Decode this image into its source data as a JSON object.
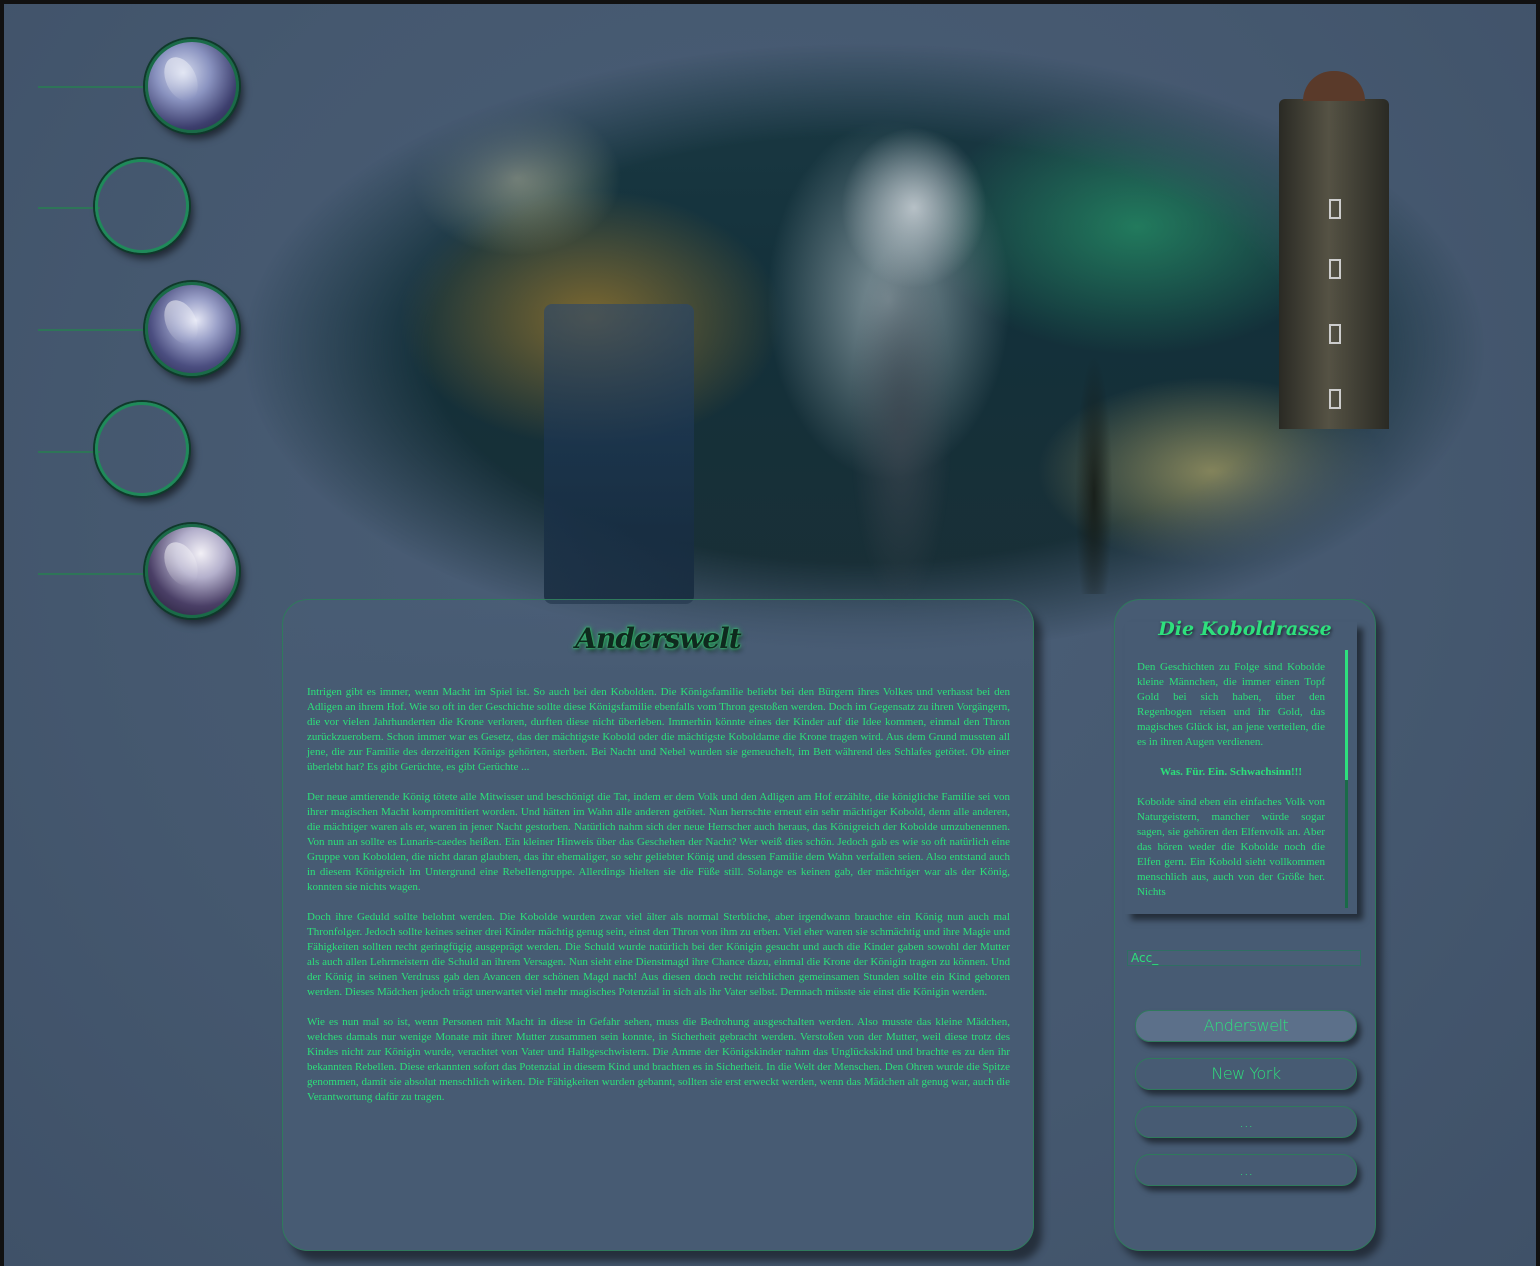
{
  "header": {
    "image_description_icon": "fantasy-banner-image"
  },
  "avatars": [
    {
      "state": "filled"
    },
    {
      "state": "empty"
    },
    {
      "state": "filled"
    },
    {
      "state": "empty"
    },
    {
      "state": "filled"
    }
  ],
  "main": {
    "title": "Anderswelt",
    "paragraphs": [
      "Intrigen gibt es immer, wenn Macht im Spiel ist. So auch bei den Kobolden. Die Königsfamilie beliebt bei den Bürgern ihres Volkes und verhasst bei den Adligen an ihrem Hof. Wie so oft in der Geschichte sollte diese Königsfamilie ebenfalls vom Thron gestoßen werden. Doch im Gegensatz zu ihren Vorgängern, die vor vielen Jahrhunderten die Krone verloren, durften diese nicht überleben. Immerhin könnte eines der Kinder auf die Idee kommen, einmal den Thron zurückzuerobern. Schon immer war es Gesetz, das der mächtigste Kobold oder die mächtigste Koboldame die Krone tragen wird. Aus dem Grund mussten all jene, die zur Familie des derzeitigen Königs gehörten, sterben. Bei Nacht und Nebel wurden sie gemeuchelt, im Bett während des Schlafes getötet. Ob einer überlebt hat? Es gibt Gerüchte, es gibt Gerüchte ...",
      "Der neue amtierende König tötete alle Mitwisser und beschönigt die Tat, indem er dem Volk und den Adligen am Hof erzählte, die königliche Familie sei von ihrer magischen Macht kompromittiert worden. Und hätten im Wahn alle anderen getötet. Nun herrschte erneut ein sehr mächtiger Kobold, denn alle anderen, die mächtiger waren als er, waren in jener Nacht gestorben. Natürlich nahm sich der neue Herrscher auch heraus, das Königreich der Kobolde umzubenennen. Von nun an sollte es Lunaris-caedes heißen. Ein kleiner Hinweis über das Geschehen der Nacht? Wer weiß dies schön. Jedoch gab es wie so oft natürlich eine Gruppe von Kobolden, die nicht daran glaubten, das ihr ehemaliger, so sehr geliebter König und dessen Familie dem Wahn verfallen seien. Also entstand auch in diesem Königreich im Untergrund eine Rebellengruppe. Allerdings hielten sie die Füße still. Solange es keinen gab, der mächtiger war als der König, konnten sie nichts wagen.",
      "Doch ihre Geduld sollte belohnt werden. Die Kobolde wurden zwar viel älter als normal Sterbliche, aber irgendwann brauchte ein König nun auch mal Thronfolger. Jedoch sollte keines seiner drei Kinder mächtig genug sein, einst den Thron von ihm zu erben. Viel eher waren sie schmächtig und ihre Magie und Fähigkeiten sollten recht geringfügig ausgeprägt werden. Die Schuld wurde natürlich bei der Königin gesucht und auch die Kinder gaben sowohl der Mutter als auch allen Lehrmeistern die Schuld an ihrem Versagen. Nun sieht eine Dienstmagd ihre Chance dazu, einmal die Krone der Königin tragen zu können. Und der König in seinen Verdruss gab den Avancen der schönen Magd nach! Aus diesen doch recht reichlichen gemeinsamen Stunden sollte ein Kind geboren werden. Dieses Mädchen jedoch trägt unerwartet viel mehr magisches Potenzial in sich als ihr Vater selbst. Demnach müsste sie einst die Königin werden.",
      "Wie es nun mal so ist, wenn Personen mit Macht in diese in Gefahr sehen, muss die Bedrohung ausgeschalten werden. Also musste das kleine Mädchen, welches damals nur wenige Monate mit ihrer Mutter zusammen sein konnte, in Sicherheit gebracht werden. Verstoßen von der Mutter, weil diese trotz des Kindes nicht zur Königin wurde, verachtet von Vater und Halbgeschwistern. Die Amme der Königskinder nahm das Unglückskind und brachte es zu den ihr bekannten Rebellen. Diese erkannten sofort das Potenzial in diesem Kind und brachten es in Sicherheit. In die Welt der Menschen. Den Ohren wurde die Spitze genommen, damit sie absolut menschlich wirken. Die Fähigkeiten wurden gebannt, sollten sie erst erweckt werden, wenn das Mädchen alt genug war, auch die Verantwortung dafür zu tragen."
    ]
  },
  "sidebar": {
    "title": "Die Koboldrasse",
    "text_p1": "Den Geschichten zu Folge sind Kobolde kleine Männchen, die immer einen Topf Gold bei sich haben, über den Regenbogen reisen und ihr Gold, das magisches Glück ist, an jene verteilen, die es in ihren Augen verdienen.",
    "text_p2": "Was. Für. Ein. Schwachsinn!!!",
    "text_p3": "Kobolde sind eben ein einfaches Volk von Naturgeistern, mancher würde sogar sagen, sie gehören den Elfenvolk an. Aber das hören weder die Kobolde noch die Elfen gern. Ein Kobold sieht vollkommen menschlich aus, auch von der Größe her. Nichts",
    "acc_value": "Acc_",
    "nav": [
      {
        "label": "Anderswelt"
      },
      {
        "label": "New York"
      },
      {
        "label": "..."
      },
      {
        "label": "..."
      }
    ]
  }
}
